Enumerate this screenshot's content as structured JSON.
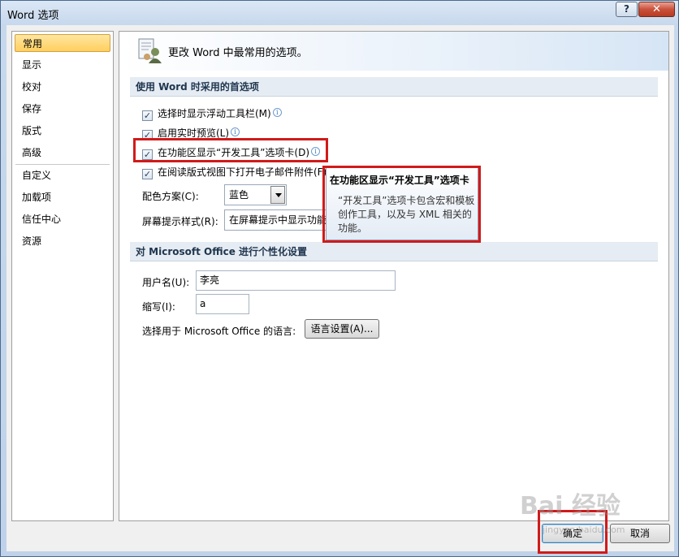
{
  "window": {
    "title": "Word 选项",
    "help_label": "?",
    "close_label": "✕"
  },
  "nav": {
    "items": [
      {
        "label": "常用"
      },
      {
        "label": "显示"
      },
      {
        "label": "校对"
      },
      {
        "label": "保存"
      },
      {
        "label": "版式"
      },
      {
        "label": "高级"
      },
      {
        "label": "自定义"
      },
      {
        "label": "加载项"
      },
      {
        "label": "信任中心"
      },
      {
        "label": "资源"
      }
    ],
    "selected": "常用"
  },
  "header": {
    "text": "更改 Word 中最常用的选项。",
    "icon": "settings-person-icon"
  },
  "section1": {
    "title": "使用 Word 时采用的首选项",
    "checkboxes": [
      {
        "label": "选择时显示浮动工具栏(M)",
        "checked": true,
        "info": true
      },
      {
        "label": "启用实时预览(L)",
        "checked": true,
        "info": true
      },
      {
        "label": "在功能区显示“开发工具”选项卡(D)",
        "checked": true,
        "info": true
      },
      {
        "label": "在阅读版式视图下打开电子邮件附件(F)",
        "checked": true,
        "info": false
      }
    ],
    "color_scheme_label": "配色方案(C):",
    "color_scheme_value": "蓝色",
    "screentip_label": "屏幕提示样式(R):",
    "screentip_value": "在屏幕提示中显示功能"
  },
  "tooltip": {
    "title": "在功能区显示“开发工具”选项卡",
    "body": "“开发工具”选项卡包含宏和模板创作工具，以及与 XML 相关的功能。"
  },
  "section2": {
    "title": "对 Microsoft Office 进行个性化设置",
    "username_label": "用户名(U):",
    "username_value": "李亮",
    "initials_label": "缩写(I):",
    "initials_value": "a",
    "language_label": "选择用于 Microsoft Office 的语言:",
    "language_button": "语言设置(A)..."
  },
  "footer": {
    "ok_label": "确定",
    "cancel_label": "取消"
  },
  "watermark": {
    "text": "Bai 经验",
    "sub": "jingyan.baidu.com"
  },
  "colors": {
    "highlight": "#d11a1a",
    "nav_selected": "#ffcf5e",
    "section_bar": "#e6ecf3"
  }
}
